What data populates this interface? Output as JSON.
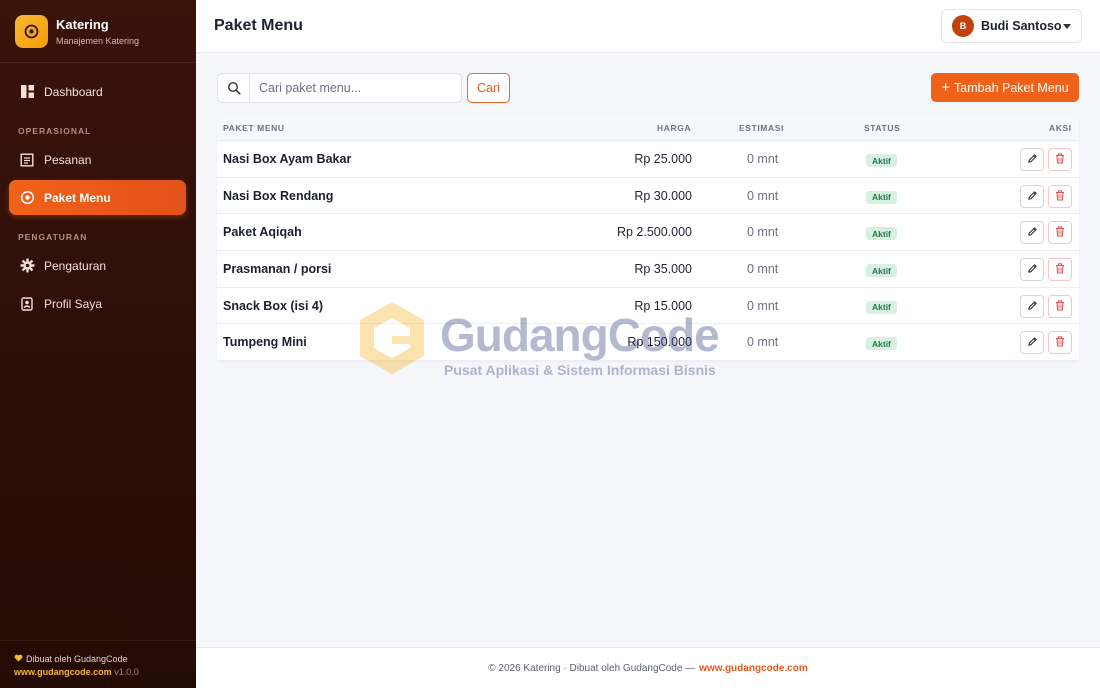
{
  "brand": {
    "title": "Katering",
    "subtitle": "Manajemen Katering"
  },
  "sidebar": {
    "items": [
      {
        "label": "Dashboard"
      },
      {
        "label": "Pesanan"
      },
      {
        "label": "Paket Menu",
        "active": true
      },
      {
        "label": "Pengaturan"
      },
      {
        "label": "Profil Saya"
      }
    ],
    "sections": [
      "OPERASIONAL",
      "PENGATURAN"
    ],
    "footer": {
      "made_by": "Dibuat oleh GudangCode",
      "site": "www.gudangcode.com",
      "version": "v1.0.0"
    }
  },
  "header": {
    "title": "Paket Menu",
    "user": {
      "initial": "B",
      "name": "Budi Santoso"
    }
  },
  "toolbar": {
    "search_placeholder": "Cari paket menu...",
    "search_button": "Cari",
    "add_button": "Tambah Paket Menu"
  },
  "table": {
    "columns": [
      "PAKET MENU",
      "HARGA",
      "ESTIMASI",
      "STATUS",
      "AKSI"
    ],
    "rows": [
      {
        "name": "Nasi Box Ayam Bakar",
        "price": "Rp 25.000",
        "estimate": "0 mnt",
        "status": "Aktif"
      },
      {
        "name": "Nasi Box Rendang",
        "price": "Rp 30.000",
        "estimate": "0 mnt",
        "status": "Aktif"
      },
      {
        "name": "Paket Aqiqah",
        "price": "Rp 2.500.000",
        "estimate": "0 mnt",
        "status": "Aktif"
      },
      {
        "name": "Prasmanan / porsi",
        "price": "Rp 35.000",
        "estimate": "0 mnt",
        "status": "Aktif"
      },
      {
        "name": "Snack Box (isi 4)",
        "price": "Rp 15.000",
        "estimate": "0 mnt",
        "status": "Aktif"
      },
      {
        "name": "Tumpeng Mini",
        "price": "Rp 150.000",
        "estimate": "0 mnt",
        "status": "Aktif"
      }
    ]
  },
  "footer": {
    "text": "© 2026 Katering · Dibuat oleh GudangCode —",
    "link": "www.gudangcode.com"
  },
  "watermark": {
    "title": "GudangCode",
    "tagline": "Pusat Aplikasi & Sistem Informasi Bisnis"
  },
  "colors": {
    "accent": "#f0621a",
    "sidebar_bg": "#2c0e07",
    "badge_bg": "#d8f0e2",
    "badge_text": "#1f7a46",
    "delete": "#e05252"
  },
  "icons": [
    "dashboard-icon",
    "orders-icon",
    "menu-package-icon",
    "gear-icon",
    "profile-icon",
    "search-icon",
    "plus-icon",
    "pencil-icon",
    "trash-icon",
    "heart-icon",
    "chevron-down-icon"
  ]
}
